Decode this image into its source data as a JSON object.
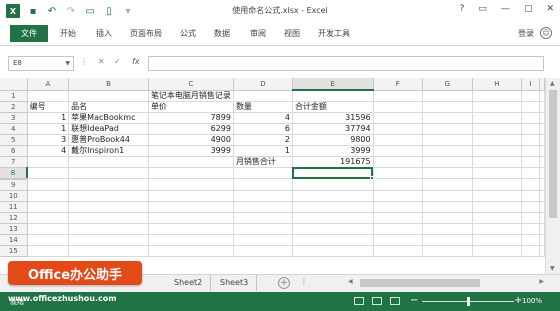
{
  "window": {
    "title": "使用命名公式.xlsx - Excel",
    "controls": [
      "?",
      "▭",
      "—",
      "▢",
      "✕"
    ]
  },
  "qat": {
    "logo": "X",
    "icons": [
      "save-icon",
      "undo-icon",
      "redo-icon",
      "open-icon",
      "new-icon",
      "customize-icon"
    ]
  },
  "ribbon": {
    "file": "文件",
    "tabs": [
      "开始",
      "插入",
      "页面布局",
      "公式",
      "数据",
      "审阅",
      "视图",
      "开发工具"
    ],
    "signin": "登录"
  },
  "formula_bar": {
    "name_box": "E8",
    "cancel": "✕",
    "enter": "✓",
    "fx": "fx",
    "formula": ""
  },
  "grid": {
    "columns": [
      "A",
      "B",
      "C",
      "D",
      "E",
      "F",
      "G",
      "H",
      "I"
    ],
    "selected_column": "E",
    "selected_row": 8,
    "rows": [
      {
        "n": 1,
        "cells": [
          "",
          "",
          "笔记本电脑月销售记录",
          "",
          "",
          "",
          "",
          "",
          ""
        ]
      },
      {
        "n": 2,
        "cells": [
          "编号",
          "品名",
          "单价",
          "数量",
          "合计金额",
          "",
          "",
          "",
          ""
        ]
      },
      {
        "n": 3,
        "cells": [
          "1",
          "苹果MacBookmc",
          "7899",
          "4",
          "31596",
          "",
          "",
          "",
          ""
        ]
      },
      {
        "n": 4,
        "cells": [
          "1",
          "联想IdeaPad",
          "6299",
          "6",
          "37794",
          "",
          "",
          "",
          ""
        ]
      },
      {
        "n": 5,
        "cells": [
          "3",
          "惠普ProBook44",
          "4900",
          "2",
          "9800",
          "",
          "",
          "",
          ""
        ]
      },
      {
        "n": 6,
        "cells": [
          "4",
          "戴尔Inspiron1",
          "3999",
          "1",
          "3999",
          "",
          "",
          "",
          ""
        ]
      },
      {
        "n": 7,
        "cells": [
          "",
          "",
          "",
          "月销售合计",
          "191675",
          "",
          "",
          "",
          ""
        ]
      },
      {
        "n": 8,
        "cells": [
          "",
          "",
          "",
          "",
          "",
          "",
          "",
          "",
          ""
        ]
      },
      {
        "n": 9,
        "cells": [
          "",
          "",
          "",
          "",
          "",
          "",
          "",
          "",
          ""
        ]
      },
      {
        "n": 10,
        "cells": [
          "",
          "",
          "",
          "",
          "",
          "",
          "",
          "",
          ""
        ]
      },
      {
        "n": 11,
        "cells": [
          "",
          "",
          "",
          "",
          "",
          "",
          "",
          "",
          ""
        ]
      },
      {
        "n": 12,
        "cells": [
          "",
          "",
          "",
          "",
          "",
          "",
          "",
          "",
          ""
        ]
      },
      {
        "n": 13,
        "cells": [
          "",
          "",
          "",
          "",
          "",
          "",
          "",
          "",
          ""
        ]
      },
      {
        "n": 14,
        "cells": [
          "",
          "",
          "",
          "",
          "",
          "",
          "",
          "",
          ""
        ]
      },
      {
        "n": 15,
        "cells": [
          "",
          "",
          "",
          "",
          "",
          "",
          "",
          "",
          ""
        ]
      }
    ]
  },
  "sheets": {
    "tabs": [
      "Sheet2",
      "Sheet3"
    ],
    "add": "+",
    "more": "⋮"
  },
  "status": {
    "ready": "就绪",
    "zoom": "100%",
    "zoom_minus": "−",
    "zoom_plus": "+",
    "zoom_fraction": 0.5
  },
  "watermark": {
    "badge": "Office办公助手",
    "url": "www.officezhushou.com"
  },
  "colors": {
    "excel_green": "#217346",
    "watermark_orange": "#e24a18"
  }
}
